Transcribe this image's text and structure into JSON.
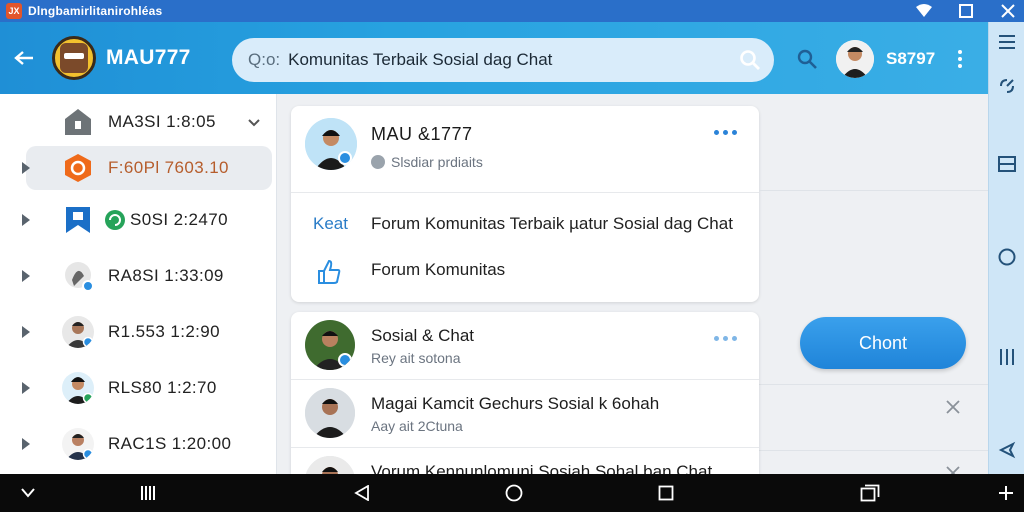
{
  "statusbar": {
    "app_icon_text": "JX",
    "title": "Dlngbamirlitanirohléas",
    "icons": [
      "wifi-icon",
      "maximize-icon",
      "close-icon"
    ]
  },
  "appbar": {
    "app_name": "MAU777",
    "search": {
      "prefix": "Q:o:",
      "query": "Komunitas  Terbaik Sosial dag Chat"
    },
    "user_code": "S8797"
  },
  "sidebar": {
    "items": [
      {
        "label": "MA3SI 1:8:05",
        "icon": "home-icon",
        "has_chevron": true
      },
      {
        "label": "F:60Pl 7603.10",
        "icon": "hexagon-icon",
        "selected": true
      },
      {
        "label": "S0SI 2:2470",
        "icon": "bookmark-icon",
        "extra_icon": "recycle-icon"
      },
      {
        "label": "RA8SI 1:33:09",
        "icon": "chat-bubble-icon"
      },
      {
        "label": "R1.553 1:2:90",
        "icon": "avatar"
      },
      {
        "label": "RLS80 1:2:70",
        "icon": "avatar"
      },
      {
        "label": "RAC1S 1:20:00",
        "icon": "avatar"
      }
    ]
  },
  "main": {
    "profile_card": {
      "name": "MAU &1777",
      "subtitle": "Slsdiar prdiaits",
      "keyword": "Keat",
      "line1": "Forum Komunitas Terbaik µatur Sosial dag Chat",
      "line2": "Forum Komunitas"
    },
    "messages": [
      {
        "title": "Sosial & Chat",
        "sub": "Rey ait sotona",
        "has_more": true
      },
      {
        "title": "Magai Kamcit Gechurs Sosial k 6ohah",
        "sub": "Aay ait 2Ctuna",
        "has_close": true
      },
      {
        "title": "Vorum Kennunlomuni Sosiah Sohal ban Chat",
        "sub": "",
        "has_close": true
      }
    ],
    "chat_button": "Chont"
  },
  "colors": {
    "accent": "#1f8fd6",
    "chat_button": "#2a8ee0",
    "status_bar": "#2a6fc9",
    "nav_bar": "#0a0a0a"
  }
}
